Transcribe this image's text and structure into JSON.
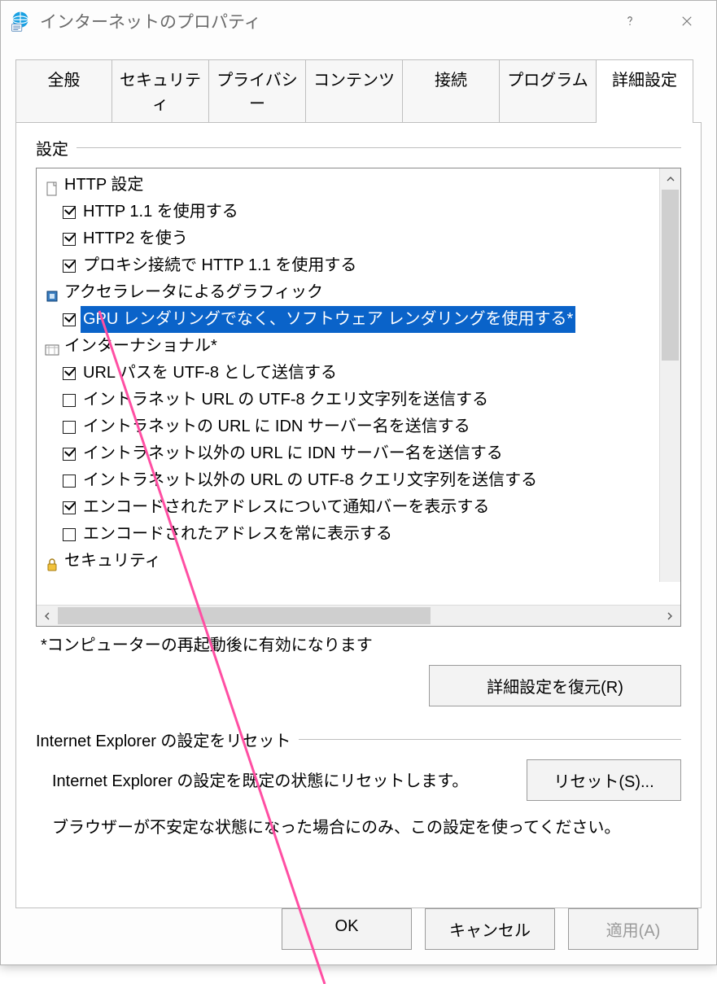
{
  "window": {
    "title": "インターネットのプロパティ"
  },
  "tabs": {
    "items": [
      {
        "label": "全般"
      },
      {
        "label": "セキュリティ"
      },
      {
        "label": "プライバシー"
      },
      {
        "label": "コンテンツ"
      },
      {
        "label": "接続"
      },
      {
        "label": "プログラム"
      },
      {
        "label": "詳細設定"
      }
    ],
    "active_index": 6
  },
  "settings": {
    "group_label": "設定",
    "categories": [
      {
        "icon": "document",
        "label": "HTTP 設定",
        "items": [
          {
            "checked": true,
            "label": "HTTP 1.1 を使用する"
          },
          {
            "checked": true,
            "label": "HTTP2 を使う"
          },
          {
            "checked": true,
            "label": "プロキシ接続で HTTP 1.1 を使用する"
          }
        ]
      },
      {
        "icon": "chip",
        "label": "アクセラレータによるグラフィック",
        "items": [
          {
            "checked": true,
            "selected": true,
            "label": "GPU レンダリングでなく、ソフトウェア レンダリングを使用する*"
          }
        ]
      },
      {
        "icon": "globe",
        "label": "インターナショナル*",
        "items": [
          {
            "checked": true,
            "label": "URL パスを UTF-8 として送信する"
          },
          {
            "checked": false,
            "label": "イントラネット URL の UTF-8 クエリ文字列を送信する"
          },
          {
            "checked": false,
            "label": "イントラネットの URL に IDN サーバー名を送信する"
          },
          {
            "checked": true,
            "label": "イントラネット以外の URL に IDN サーバー名を送信する"
          },
          {
            "checked": false,
            "label": "イントラネット以外の URL の UTF-8 クエリ文字列を送信する"
          },
          {
            "checked": true,
            "label": "エンコードされたアドレスについて通知バーを表示する"
          },
          {
            "checked": false,
            "label": "エンコードされたアドレスを常に表示する"
          }
        ]
      },
      {
        "icon": "lock",
        "label": "セキュリティ",
        "items": []
      }
    ],
    "footnote": "*コンピューターの再起動後に有効になります",
    "restore_button": "詳細設定を復元(R)"
  },
  "reset": {
    "group_label": "Internet Explorer の設定をリセット",
    "description": "Internet Explorer の設定を既定の状態にリセットします。",
    "button": "リセット(S)...",
    "warning": "ブラウザーが不安定な状態になった場合にのみ、この設定を使ってください。"
  },
  "footer": {
    "ok": "OK",
    "cancel": "キャンセル",
    "apply": "適用(A)"
  }
}
